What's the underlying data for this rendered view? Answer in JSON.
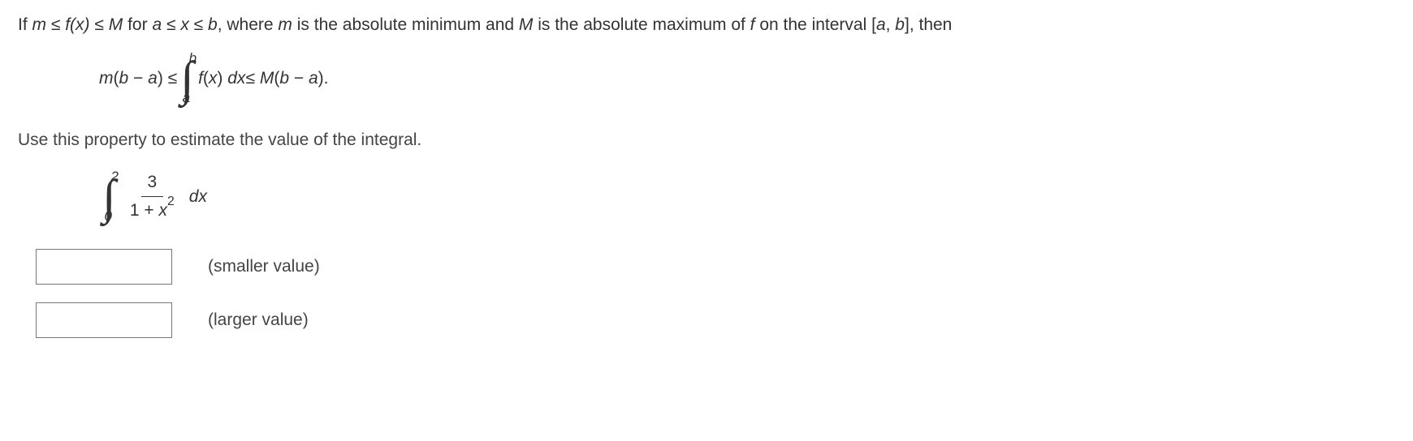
{
  "intro_parts": {
    "p1": "If ",
    "m": "m",
    "le1": " ≤ ",
    "fx": "f(x)",
    "le2": " ≤ ",
    "Mv": "M",
    "for": " for ",
    "a": "a",
    "le3": " ≤ ",
    "x": "x",
    "le4": " ≤ ",
    "b": "b",
    "where": ", where ",
    "m2": "m",
    "mid1": " is the absolute minimum and ",
    "M2": "M",
    "mid2": " is the absolute maximum of ",
    "f": "f",
    "mid3": " on the interval [",
    "a2": "a",
    "comma": ", ",
    "b2": "b",
    "end": "], then"
  },
  "property": {
    "lhs1": "m",
    "lhs2": "(",
    "lhs3": "b",
    "lhs4": " − ",
    "lhs5": "a",
    "lhs6": ") ≤ ",
    "upper": "b",
    "lower": "a",
    "integrand1": "f",
    "integrand2": "(",
    "integrand3": "x",
    "integrand4": ") ",
    "dx1": "dx",
    "rhs1": " ≤ ",
    "rhs2": "M",
    "rhs3": "(",
    "rhs4": "b",
    "rhs5": " − ",
    "rhs6": "a",
    "rhs7": ")."
  },
  "instruction": "Use this property to estimate the value of the integral.",
  "problem": {
    "upper": "2",
    "lower": "0",
    "num": "3",
    "den1": "1 + ",
    "den2": "x",
    "den3": "2",
    "dx": "dx"
  },
  "answers": {
    "smaller": {
      "value": "",
      "label": "(smaller value)"
    },
    "larger": {
      "value": "",
      "label": "(larger value)"
    }
  }
}
